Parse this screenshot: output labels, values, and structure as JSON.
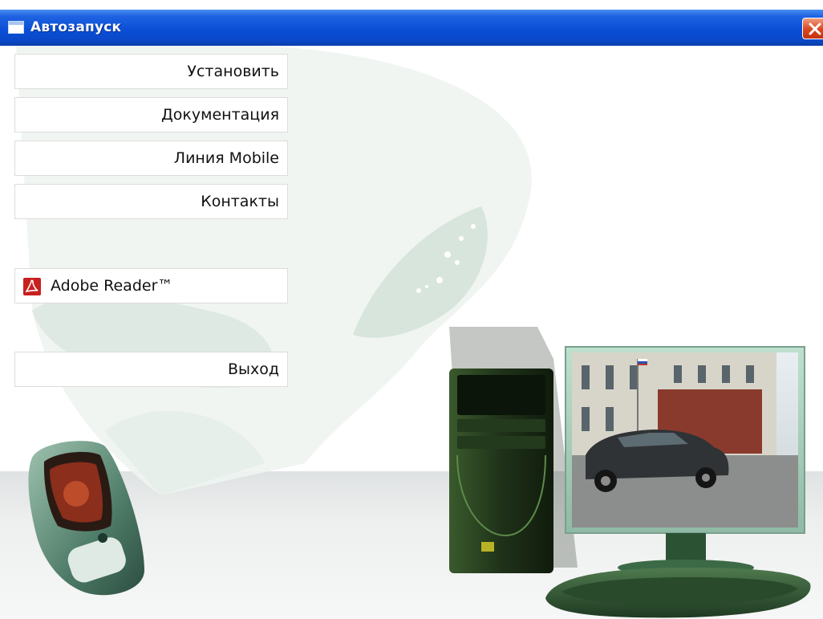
{
  "window": {
    "title": "Автозапуск",
    "close_icon": "close-x-icon",
    "accent_color": "#0a4fd6",
    "close_color": "#d9461e"
  },
  "menu": {
    "install": "Установить",
    "documentation": "Документация",
    "mobile_line": "Линия Mobile",
    "contacts": "Контакты",
    "adobe_reader": "Adobe Reader™",
    "exit": "Выход"
  },
  "icons": {
    "adobe": "adobe-reader-icon",
    "window": "app-window-icon"
  }
}
